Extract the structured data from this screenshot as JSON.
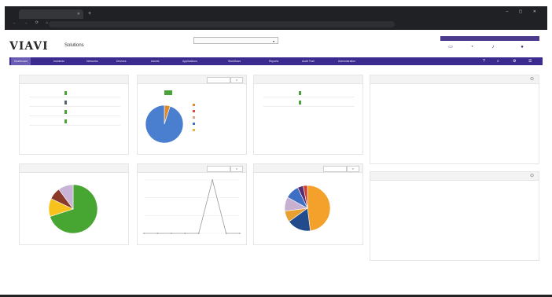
{
  "browser": {
    "tab_title": "",
    "url": "",
    "nav": "←  →  ⟳  ⌂",
    "window_controls": "–  ▢  ✕",
    "new_tab": "+"
  },
  "header": {
    "logo": "VIAVI",
    "product": "Solutions",
    "org_select": "",
    "user": "",
    "icons": [
      {
        "name": "monitor-icon",
        "label": ""
      },
      {
        "name": "gauge-icon",
        "label": ""
      },
      {
        "name": "bell-icon",
        "label": ""
      },
      {
        "name": "user-icon",
        "label": ""
      }
    ]
  },
  "nav": {
    "items": [
      {
        "label": "Dashboard",
        "active": true
      },
      {
        "label": "Incidents",
        "active": false
      },
      {
        "label": "Networks",
        "active": false
      },
      {
        "label": "Devices",
        "active": false
      },
      {
        "label": "Assets",
        "active": false
      },
      {
        "label": "Applications",
        "active": false
      },
      {
        "label": "Workflows",
        "active": false
      },
      {
        "label": "Reports",
        "active": false
      },
      {
        "label": "Audit Trail",
        "active": false
      },
      {
        "label": "Administration",
        "active": false
      }
    ]
  },
  "panels": {
    "status": {
      "title": "",
      "rows": [
        {
          "label": "",
          "color": "#4aa33a"
        },
        {
          "label": "",
          "color": "#556070"
        },
        {
          "label": "",
          "color": "#4aa33a"
        },
        {
          "label": "",
          "color": "#4aa33a"
        }
      ]
    },
    "compliance": {
      "title": "",
      "button": "",
      "badge": "",
      "legend": [
        {
          "label": "",
          "color": "#e08a2e"
        },
        {
          "label": "",
          "color": "#e04a3a"
        },
        {
          "label": "",
          "color": "#e0a080"
        },
        {
          "label": "",
          "color": "#3d70c8"
        },
        {
          "label": "",
          "color": "#f0b040"
        }
      ]
    },
    "third": {
      "title": "",
      "rows": [
        {
          "label": "",
          "color": "#4aa33a"
        },
        {
          "label": "",
          "color": "#4aa33a"
        }
      ]
    },
    "activity": {
      "title": "",
      "rows": [
        {
          "time": "",
          "text": ""
        },
        {
          "time": "",
          "text": ""
        },
        {
          "time": "",
          "text": ""
        },
        {
          "time": "",
          "text": ""
        },
        {
          "time": "",
          "text": ""
        }
      ],
      "more": ""
    },
    "alerts": {
      "title": "",
      "rows": [
        {
          "time": "",
          "text": ""
        },
        {
          "time": "",
          "text": ""
        },
        {
          "time": "",
          "text": ""
        },
        {
          "time": "",
          "text": ""
        },
        {
          "time": "",
          "text": ""
        }
      ],
      "more": ""
    },
    "pie1": {
      "title": ""
    },
    "line": {
      "title": "",
      "button": ""
    },
    "pie2": {
      "title": "",
      "button": ""
    }
  },
  "colors": {
    "brand": "#3b2b8e",
    "accent": "#6a5cb3",
    "green": "#4aa33a",
    "blue": "#3d70c8",
    "orange": "#f0a030"
  },
  "chart_data": [
    {
      "type": "pie",
      "values": [
        0.05,
        0.95
      ],
      "colors": [
        "#e08a2e",
        "#4a7fd0"
      ]
    },
    {
      "type": "pie",
      "values": [
        0.7,
        0.12,
        0.08,
        0.1
      ],
      "colors": [
        "#47a531",
        "#f7c21c",
        "#8b3a2a",
        "#c9b3d6"
      ]
    },
    {
      "type": "line",
      "x": [
        1,
        2,
        3,
        4,
        5,
        6,
        7,
        8
      ],
      "values": [
        0,
        0,
        0,
        0,
        0,
        1,
        0,
        0
      ],
      "ylim": [
        0,
        1
      ],
      "color": "#999999"
    },
    {
      "type": "pie",
      "values": [
        0.48,
        0.17,
        0.08,
        0.1,
        0.1,
        0.04,
        0.03
      ],
      "colors": [
        "#f3a12a",
        "#214b8c",
        "#e8a030",
        "#c8b0d0",
        "#3d6fc4",
        "#5a2e6e",
        "#d04030"
      ]
    }
  ]
}
